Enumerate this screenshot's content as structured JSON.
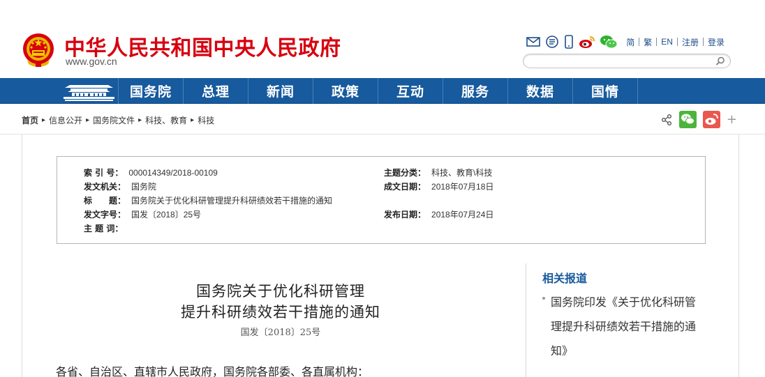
{
  "header": {
    "site_title": "中华人民共和国中央人民政府",
    "site_url": "www.gov.cn",
    "emblem_icon": "national-emblem-icon",
    "brand_red": "#d7000f",
    "tools": [
      "email-icon",
      "rss-icon",
      "mobile-icon",
      "weibo-icon",
      "wechat-icon"
    ],
    "lang_links": [
      "简",
      "繁",
      "EN",
      "注册",
      "登录"
    ],
    "search": {
      "placeholder": ""
    }
  },
  "nav": {
    "home_icon": "tiananmen-icon",
    "bg_color": "#175a9d",
    "items": [
      "国务院",
      "总理",
      "新闻",
      "政策",
      "互动",
      "服务",
      "数据",
      "国情"
    ]
  },
  "breadcrumb": {
    "items": [
      "首页",
      "信息公开",
      "国务院文件",
      "科技、教育",
      "科技"
    ]
  },
  "share": [
    "share-icon",
    "wechat-share-icon",
    "weibo-share-icon",
    "plus-icon"
  ],
  "info": {
    "index_no_label": "索 引 号：",
    "index_no": "000014349/2018-00109",
    "issuer_label": "发文机关：",
    "issuer": "国务院",
    "title_label": "标　　题：",
    "title": "国务院关于优化科研管理提升科研绩效若干措施的通知",
    "doc_no_label": "发文字号：",
    "doc_no": "国发〔2018〕25号",
    "keywords_label": "主 题 词：",
    "keywords": "",
    "category_label": "主题分类：",
    "category": "科技、教育\\科技",
    "written_date_label": "成文日期：",
    "written_date": "2018年07月18日",
    "publish_date_label": "发布日期：",
    "publish_date": "2018年07月24日"
  },
  "document": {
    "title_line1": "国务院关于优化科研管理",
    "title_line2": "提升科研绩效若干措施的通知",
    "number": "国发〔2018〕25号",
    "salutation": "各省、自治区、直辖市人民政府，国务院各部委、各直属机构："
  },
  "sidebar": {
    "title": "相关报道",
    "link": "国务院印发《关于优化科研管理提升科研绩效若干措施的通知》"
  }
}
